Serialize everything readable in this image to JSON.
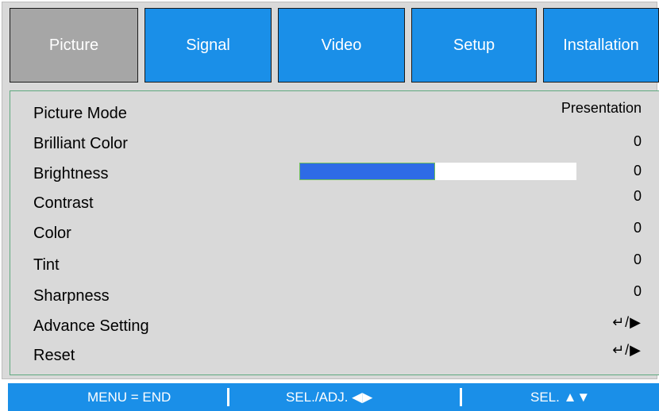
{
  "tabs": [
    {
      "label": "Picture",
      "active": true
    },
    {
      "label": "Signal",
      "active": false
    },
    {
      "label": "Video",
      "active": false
    },
    {
      "label": "Setup",
      "active": false
    },
    {
      "label": "Installation",
      "active": false
    }
  ],
  "menu": {
    "rows": [
      {
        "label": "Picture Mode",
        "value": "Presentation"
      },
      {
        "label": "Brilliant Color",
        "value": "0"
      },
      {
        "label": "Brightness",
        "value": "0",
        "level": 0.49
      },
      {
        "label": "Contrast",
        "value": "0"
      },
      {
        "label": "Color",
        "value": "0"
      },
      {
        "label": "Tint",
        "value": "0"
      },
      {
        "label": "Sharpness",
        "value": "0"
      },
      {
        "label": "Advance Setting",
        "value": "↵/▶",
        "icon": "enter-right-icon"
      },
      {
        "label": "Reset",
        "value": "↵/▶",
        "icon": "enter-right-icon"
      }
    ]
  },
  "footer": {
    "menu_end": "MENU = END",
    "sel_adj": "SEL./ADJ. ◀▶",
    "sel": "SEL. ▲▼"
  },
  "colors": {
    "tab_blue": "#1a8fe8",
    "tab_active": "#a6a6a6",
    "panel_bg": "#d9d9d9",
    "slider_fill": "#2e6be6",
    "footer_blue": "#1a8fe8"
  }
}
